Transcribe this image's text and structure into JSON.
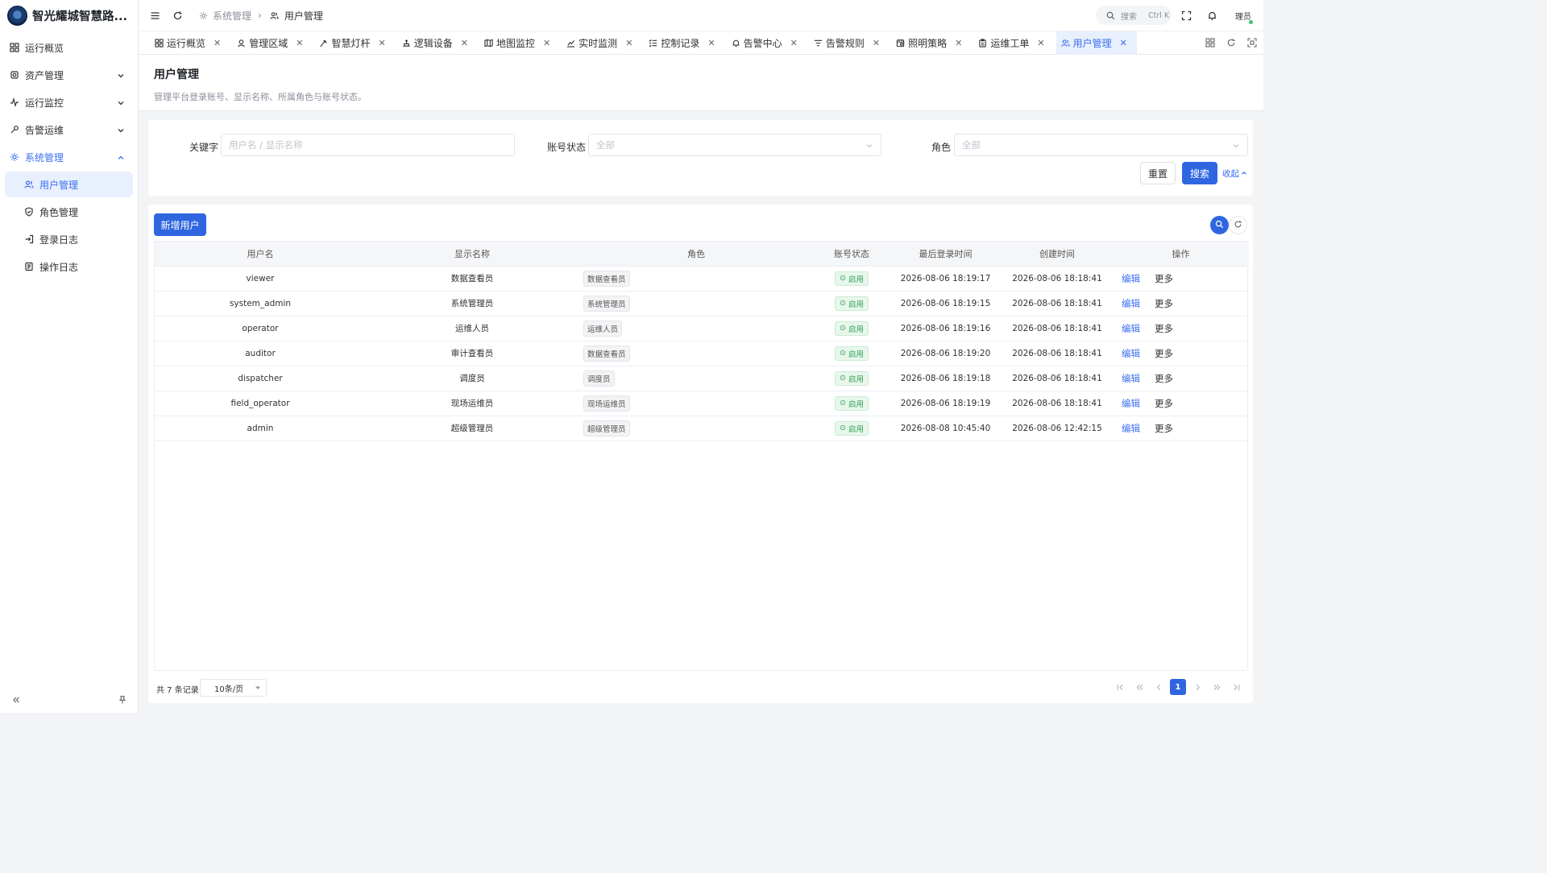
{
  "app": {
    "title": "智光耀城智慧路..."
  },
  "sidebar": {
    "items": [
      {
        "label": "运行概览",
        "icon": "grid-icon"
      },
      {
        "label": "资产管理",
        "icon": "gear-chip-icon"
      },
      {
        "label": "运行监控",
        "icon": "pulse-icon"
      },
      {
        "label": "告警运维",
        "icon": "wrench-icon"
      },
      {
        "label": "系统管理",
        "icon": "settings-icon"
      }
    ],
    "sub_items": [
      {
        "label": "用户管理",
        "icon": "users-icon"
      },
      {
        "label": "角色管理",
        "icon": "shield-icon"
      },
      {
        "label": "登录日志",
        "icon": "login-icon"
      },
      {
        "label": "操作日志",
        "icon": "log-icon"
      }
    ]
  },
  "header": {
    "breadcrumb": [
      "系统管理",
      "用户管理"
    ],
    "search_placeholder": "搜索",
    "search_shortcut": "Ctrl K",
    "avatar_text": "理员"
  },
  "tabs": [
    {
      "label": "运行概览",
      "icon": "grid-icon"
    },
    {
      "label": "管理区域",
      "icon": "area-icon"
    },
    {
      "label": "智慧灯杆",
      "icon": "lamp-icon"
    },
    {
      "label": "逻辑设备",
      "icon": "device-icon"
    },
    {
      "label": "地图监控",
      "icon": "map-icon"
    },
    {
      "label": "实时监测",
      "icon": "chart-icon"
    },
    {
      "label": "控制记录",
      "icon": "list-icon"
    },
    {
      "label": "告警中心",
      "icon": "bell-icon"
    },
    {
      "label": "告警规则",
      "icon": "filter-icon"
    },
    {
      "label": "照明策略",
      "icon": "calendar-icon"
    },
    {
      "label": "运维工单",
      "icon": "clipboard-icon"
    },
    {
      "label": "用户管理",
      "icon": "users-icon"
    }
  ],
  "page": {
    "title": "用户管理",
    "description": "管理平台登录账号、显示名称、所属角色与账号状态。"
  },
  "filters": {
    "keyword_label": "关键字",
    "keyword_placeholder": "用户名 / 显示名称",
    "status_label": "账号状态",
    "status_value": "全部",
    "role_label": "角色",
    "role_value": "全部",
    "reset_label": "重置",
    "search_label": "搜索",
    "collapse_label": "收起"
  },
  "table": {
    "add_label": "新增用户",
    "columns": [
      "用户名",
      "显示名称",
      "角色",
      "账号状态",
      "最后登录时间",
      "创建时间",
      "操作"
    ],
    "rows": [
      {
        "username": "viewer",
        "display": "数据查看员",
        "role": "数据查看员",
        "status": "启用",
        "last_login": "2026-08-06 18:19:17",
        "created": "2026-08-06 18:18:41",
        "edit": "编辑",
        "more": "更多"
      },
      {
        "username": "system_admin",
        "display": "系统管理员",
        "role": "系统管理员",
        "status": "启用",
        "last_login": "2026-08-06 18:19:15",
        "created": "2026-08-06 18:18:41",
        "edit": "编辑",
        "more": "更多"
      },
      {
        "username": "operator",
        "display": "运维人员",
        "role": "运维人员",
        "status": "启用",
        "last_login": "2026-08-06 18:19:16",
        "created": "2026-08-06 18:18:41",
        "edit": "编辑",
        "more": "更多"
      },
      {
        "username": "auditor",
        "display": "审计查看员",
        "role": "数据查看员",
        "status": "启用",
        "last_login": "2026-08-06 18:19:20",
        "created": "2026-08-06 18:18:41",
        "edit": "编辑",
        "more": "更多"
      },
      {
        "username": "dispatcher",
        "display": "调度员",
        "role": "调度员",
        "status": "启用",
        "last_login": "2026-08-06 18:19:18",
        "created": "2026-08-06 18:18:41",
        "edit": "编辑",
        "more": "更多"
      },
      {
        "username": "field_operator",
        "display": "现场运维员",
        "role": "现场运维员",
        "status": "启用",
        "last_login": "2026-08-06 18:19:19",
        "created": "2026-08-06 18:18:41",
        "edit": "编辑",
        "more": "更多"
      },
      {
        "username": "admin",
        "display": "超级管理员",
        "role": "超级管理员",
        "status": "启用",
        "last_login": "2026-08-08 10:45:40",
        "created": "2026-08-06 12:42:15",
        "edit": "编辑",
        "more": "更多"
      }
    ]
  },
  "pagination": {
    "total_text": "共 7 条记录",
    "page_size": "10条/页",
    "current_page": "1"
  },
  "colors": {
    "accent": "#2f66e0",
    "active_bg": "#e8effd",
    "status_green": "#2f9e55"
  }
}
